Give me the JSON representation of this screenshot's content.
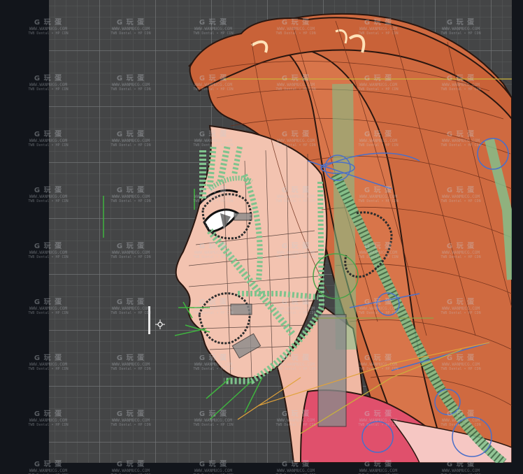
{
  "viewport": {
    "background": "#444546",
    "grid_color": "#78797b"
  },
  "model": {
    "hair_color": "#cf6a40",
    "skin_color": "#f3c3b0",
    "bone_color": "#7fc38d",
    "control_circle_color": "#4a6fc9",
    "clothing_color": "#e0506c"
  },
  "watermark": {
    "logo": "G 玩 蛋",
    "url": "WWW.WANMUCG.COM",
    "sub": "TWB Dental • HP CDN"
  },
  "icons": {
    "pivot": "crosshair-icon"
  }
}
